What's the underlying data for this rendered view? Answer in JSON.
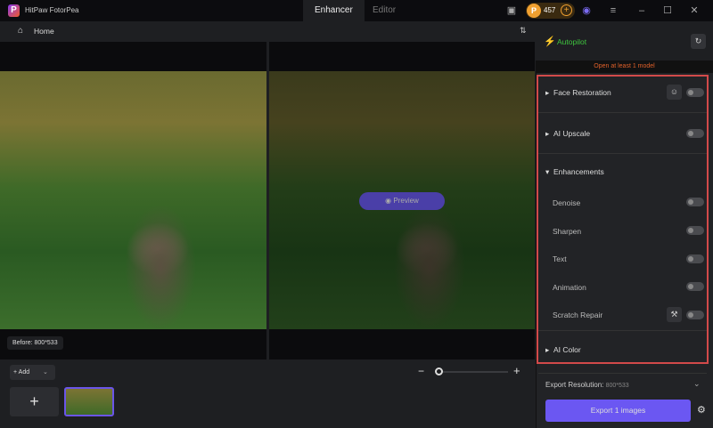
{
  "app": {
    "title": "HitPaw FotorPea",
    "logo_letter": "P"
  },
  "tabs": [
    {
      "label": "Enhancer"
    },
    {
      "label": "Editor"
    }
  ],
  "coins": {
    "count": "457"
  },
  "toolbar": {
    "home": "Home"
  },
  "canvas": {
    "preview": "Preview",
    "before_label": "Before: 800*533"
  },
  "bottom": {
    "add": "Add"
  },
  "sidebar": {
    "autopilot": "Autopilot",
    "warning": "Open at least 1 model",
    "face_restoration": "Face Restoration",
    "ai_upscale": "AI Upscale",
    "enhancements": "Enhancements",
    "subs": [
      "Denoise",
      "Sharpen",
      "Text",
      "Animation",
      "Scratch Repair"
    ],
    "ai_color": "AI Color",
    "export_res_label": "Export Resolution:",
    "export_res_value": "800*533",
    "export_button": "Export 1 images"
  },
  "colors": {
    "accent": "#6b57f2",
    "autopilot": "#3ec43e",
    "warning": "#e0602a",
    "highlight": "#d24a4a"
  }
}
